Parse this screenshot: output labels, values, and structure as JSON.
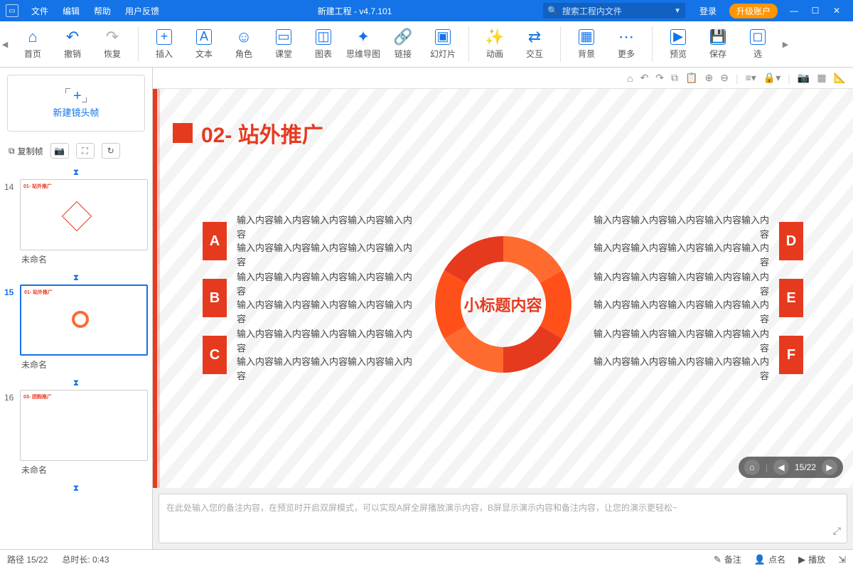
{
  "menu": {
    "file": "文件",
    "edit": "编辑",
    "help": "帮助",
    "feedback": "用户反馈"
  },
  "window": {
    "title": "新建工程 - v4.7.101"
  },
  "search": {
    "placeholder": "搜索工程内文件"
  },
  "account": {
    "login": "登录",
    "upgrade": "升级账户"
  },
  "toolbar": {
    "home": "首页",
    "undo": "撤销",
    "redo": "恢复",
    "insert": "插入",
    "text": "文本",
    "role": "角色",
    "class": "课堂",
    "chart": "图表",
    "mindmap": "思维导图",
    "link": "链接",
    "slideshow": "幻灯片",
    "anim": "动画",
    "interact": "交互",
    "bg": "背景",
    "more": "更多",
    "preview": "预览",
    "save": "保存",
    "select": "选"
  },
  "leftpane": {
    "newframe": "新建镜头帧",
    "copyframe": "复制帧"
  },
  "thumbs": [
    {
      "num": "14",
      "name": "未命名",
      "title": "01- 站外推广"
    },
    {
      "num": "15",
      "name": "未命名",
      "title": "01- 站外推广",
      "selected": true
    },
    {
      "num": "16",
      "name": "未命名",
      "title": "03- 团购推广"
    }
  ],
  "slide": {
    "title": "02- 站外推广",
    "center": "小标题内容",
    "items": {
      "A": {
        "l1": "输入内容输入内容输入内容输入内容输入内容",
        "l2": "输入内容输入内容输入内容输入内容输入内容"
      },
      "B": {
        "l1": "输入内容输入内容输入内容输入内容输入内容",
        "l2": "输入内容输入内容输入内容输入内容输入内容"
      },
      "C": {
        "l1": "输入内容输入内容输入内容输入内容输入内容",
        "l2": "输入内容输入内容输入内容输入内容输入内容"
      },
      "D": {
        "l1": "输入内容输入内容输入内容输入内容输入内容",
        "l2": "输入内容输入内容输入内容输入内容输入内容"
      },
      "E": {
        "l1": "输入内容输入内容输入内容输入内容输入内容",
        "l2": "输入内容输入内容输入内容输入内容输入内容"
      },
      "F": {
        "l1": "输入内容输入内容输入内容输入内容输入内容",
        "l2": "输入内容输入内容输入内容输入内容输入内容"
      }
    },
    "page": "15/22"
  },
  "notes": {
    "placeholder": "在此处输入您的备注内容，在预览时开启双屏模式，可以实现A屏全屏播放演示内容，B屏显示演示内容和备注内容，让您的演示更轻松~"
  },
  "status": {
    "path": "路径 15/22",
    "duration": "总时长: 0:43",
    "notes": "备注",
    "author": "点名",
    "play": "播放"
  }
}
